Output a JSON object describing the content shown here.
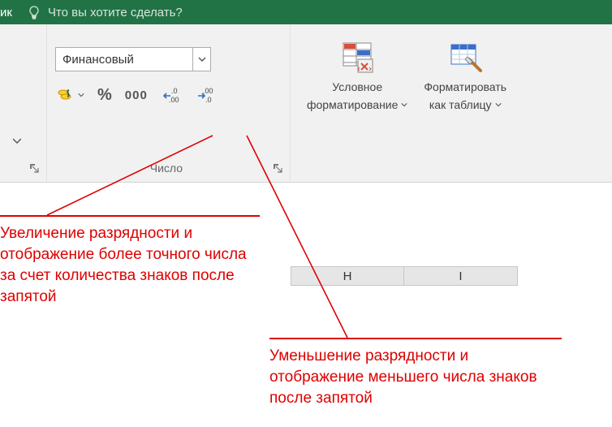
{
  "titlebar": {
    "tab_tail": "ик",
    "tell_me": "Что вы хотите сделать?"
  },
  "number_group": {
    "format_value": "Финансовый",
    "percent": "%",
    "thousands": "000",
    "label": "Число"
  },
  "styles_group": {
    "cond_fmt_line1": "Условное",
    "cond_fmt_line2": "форматирование",
    "fmt_table_line1": "Форматировать",
    "fmt_table_line2": "как таблицу"
  },
  "columns": {
    "h": "H",
    "i": "I"
  },
  "annotations": {
    "increase": "Увеличение разрядности и отображение более точного числа за счет количества знаков после запятой",
    "decrease": "Уменьшение разрядности и отображение меньшего числа знаков после запятой"
  }
}
